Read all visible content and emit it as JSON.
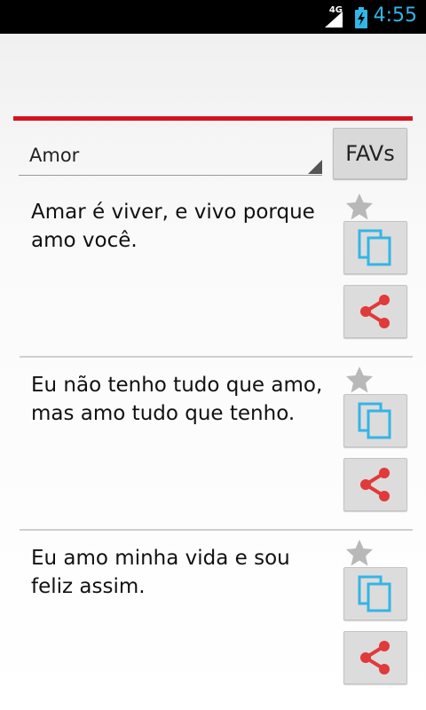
{
  "status_bar": {
    "network": "4G",
    "time": "4:55"
  },
  "category_spinner": {
    "selected": "Amor"
  },
  "favs_button": {
    "label": "FAVs"
  },
  "quotes": [
    {
      "text": "Amar é viver, e vivo porque amo você."
    },
    {
      "text": "Eu não tenho tudo que amo, mas amo tudo que tenho."
    },
    {
      "text": "Eu amo minha vida e sou feliz assim."
    }
  ],
  "colors": {
    "accent_red": "#d6141d",
    "holo_blue": "#33b5e5",
    "share_red": "#e03a3a"
  }
}
